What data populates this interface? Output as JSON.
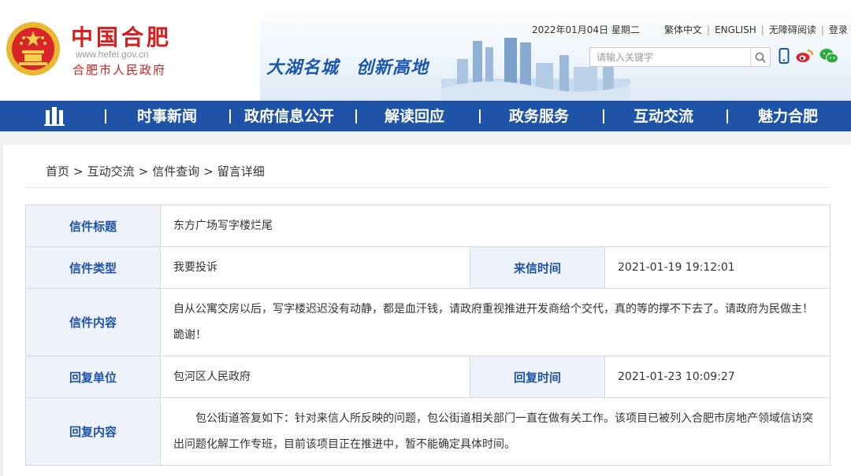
{
  "header": {
    "site_name": "中国合肥",
    "site_url": "www.hefei.gov.cn",
    "site_gov": "合肥市人民政府",
    "slogan": [
      "大湖名城",
      "创新高地"
    ],
    "date": "2022年01月04日 星期二",
    "top_links": [
      "繁体中文",
      "ENGLISH",
      "无障碍阅读",
      "登录"
    ],
    "search_placeholder": "请输入关键字",
    "colors": {
      "brand_red": "#d21f1f",
      "nav_blue": "#1e53a8",
      "label_bg": "#eef2fb"
    }
  },
  "nav": {
    "items": [
      "时事新闻",
      "政府信息公开",
      "解读回应",
      "政务服务",
      "互动交流",
      "魅力合肥"
    ]
  },
  "breadcrumb": [
    "首页",
    "互动交流",
    "信件查询",
    "留言详细"
  ],
  "letter": {
    "title_label": "信件标题",
    "title": "东方广场写字楼烂尾",
    "type_label": "信件类型",
    "type": "我要投诉",
    "time_label": "来信时间",
    "time": "2021-01-19 19:12:01",
    "content_label": "信件内容",
    "content": "自从公寓交房以后，写字楼迟迟没有动静，都是血汗钱，请政府重视推进开发商给个交代，真的等的撑不下去了。请政府为民做主！跪谢！",
    "reply_unit_label": "回复单位",
    "reply_unit": "包河区人民政府",
    "reply_time_label": "回复时间",
    "reply_time": "2021-01-23 10:09:27",
    "reply_content_label": "回复内容",
    "reply_content": "包公街道答复如下：针对来信人所反映的问题，包公街道相关部门一直在做有关工作。该项目已被列入合肥市房地产领域信访突出问题化解工作专班，目前该项目正在推进中，暂不能确定具体时间。"
  }
}
